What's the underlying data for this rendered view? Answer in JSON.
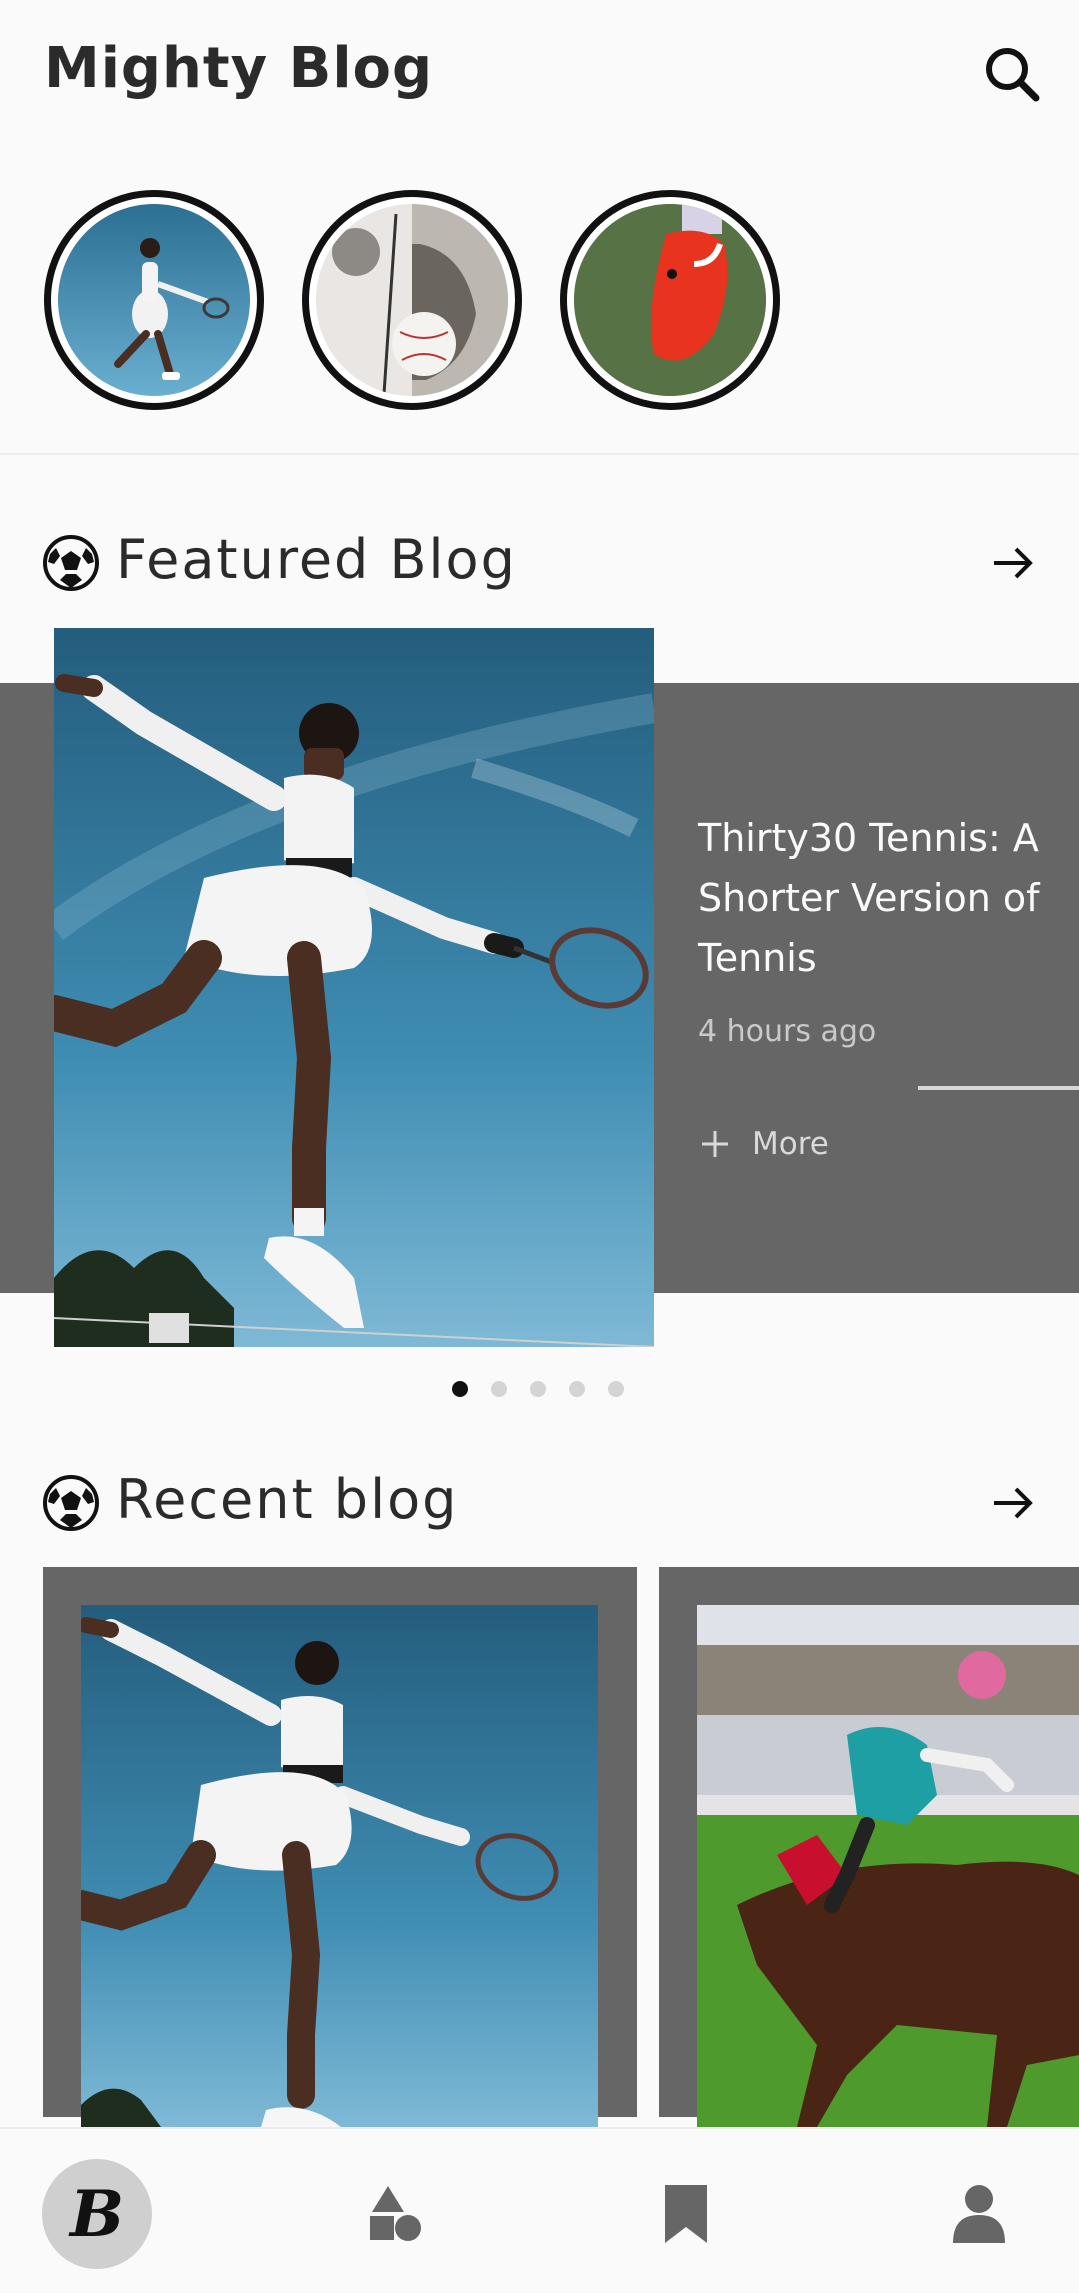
{
  "app": {
    "title": "Mighty Blog"
  },
  "stories": [
    {
      "name": "Tennis player story"
    },
    {
      "name": "Baseball movie story"
    },
    {
      "name": "Red football boot story"
    }
  ],
  "featured": {
    "heading": "Featured Blog",
    "post": {
      "title": "Thirty30 Tennis: A Shorter Version of Tennis",
      "time": "4 hours ago",
      "more_label": "More"
    },
    "carousel": {
      "count": 5,
      "active": 1
    }
  },
  "recent": {
    "heading": "Recent blog"
  },
  "bottom_nav": {
    "home_glyph": "B",
    "items": [
      "home",
      "categories",
      "bookmarks",
      "profile"
    ]
  },
  "icons": {
    "search": "search-icon",
    "section": "soccer-ball-icon",
    "arrow": "arrow-right-icon",
    "plus": "plus-icon",
    "categories": "shapes-icon",
    "bookmark": "bookmark-icon",
    "profile": "person-icon"
  },
  "colors": {
    "card_background": "#666666",
    "page_background": "#fafafb",
    "active_dot": "#111111",
    "inactive_dot": "#d4d4d4"
  }
}
